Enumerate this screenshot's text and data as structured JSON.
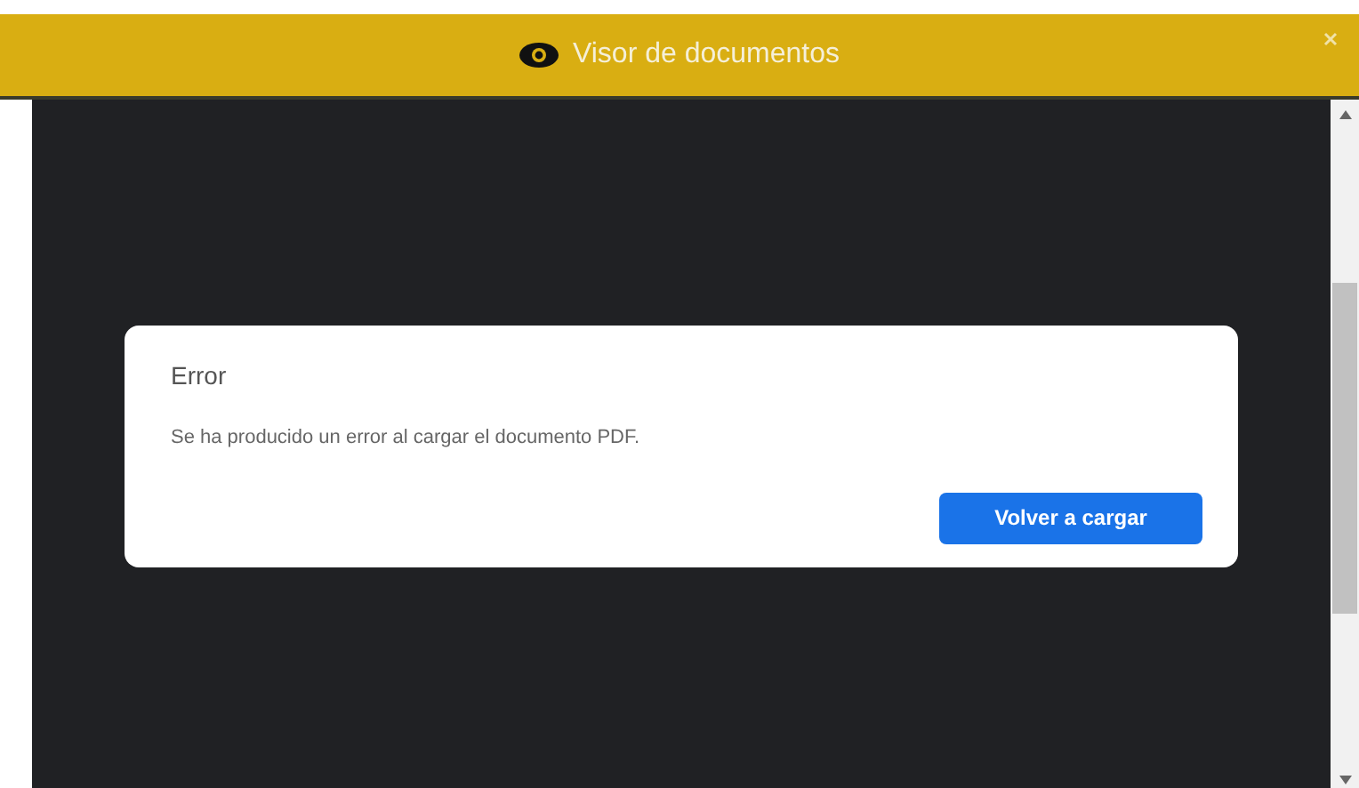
{
  "window": {
    "title": "Visor de documentos"
  },
  "dialog": {
    "title": "Error",
    "message": "Se ha producido un error al cargar el documento PDF.",
    "button": "Volver a cargar"
  }
}
